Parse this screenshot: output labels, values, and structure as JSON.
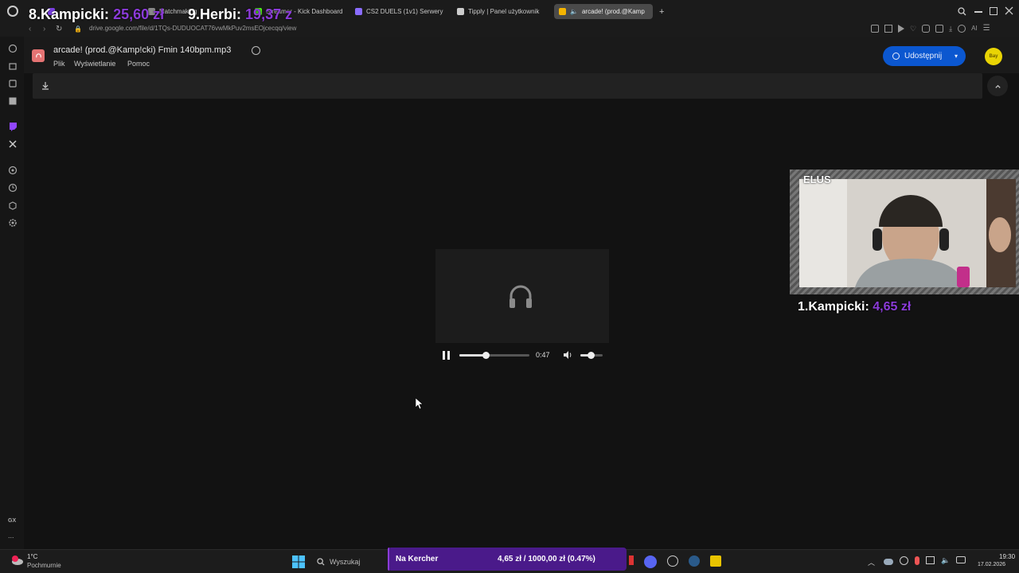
{
  "browser": {
    "tabs": [
      {
        "label": "",
        "color": "#7b3fe4"
      },
      {
        "label": "Matchmaking",
        "color": "#888888"
      },
      {
        "label": "Streamer - Kick Dashboard",
        "color": "#53fc18"
      },
      {
        "label": "CS2 DUELS (1v1) Serwery",
        "color": "#8a6cff"
      },
      {
        "label": "Tipply | Panel użytkownik",
        "color": "#cccccc"
      },
      {
        "label": "arcade! (prod.@Kamp",
        "color": "#f4b400"
      }
    ],
    "new_tab": "+",
    "url": "drive.google.com/file/d/1TQs-DUDUOCAT76vwMkPuv2msEOjcecqq/view"
  },
  "drive": {
    "filename": "arcade! (prod.@Kamp!cki) Fmin 140bpm.mp3",
    "menu": [
      "Plik",
      "Wyświetlanie",
      "Pomoc"
    ],
    "share_label": "Udostępnij",
    "avatar_text": "Bay"
  },
  "player": {
    "time": "0:47",
    "progress": 0.37,
    "volume": 0.45,
    "state": "playing"
  },
  "overlay": {
    "top_ranks": [
      {
        "rank": "8.",
        "name": "Kampicki:",
        "amount": "25,60 zł"
      },
      {
        "rank": "9.",
        "name": "Herbi:",
        "amount": "19,37 z"
      }
    ],
    "cam_name": "ELUS",
    "cam_rank": {
      "rank": "1.",
      "name": "Kampicki:",
      "amount": "4,65 zł"
    },
    "accent": "#8b3bd8"
  },
  "taskbar": {
    "weather_temp": "1°C",
    "weather_desc": "Pochmurnie",
    "search_placeholder": "Wyszukaj",
    "goal_label": "Na Kercher",
    "goal_value": "4,65 zł / 1000,00 zł (0.47%)",
    "goal_fraction": 0.0047,
    "time": "19:30",
    "date": "17.02.2026"
  },
  "sidebar": {
    "gx_label": "GX",
    "more_label": "..."
  }
}
